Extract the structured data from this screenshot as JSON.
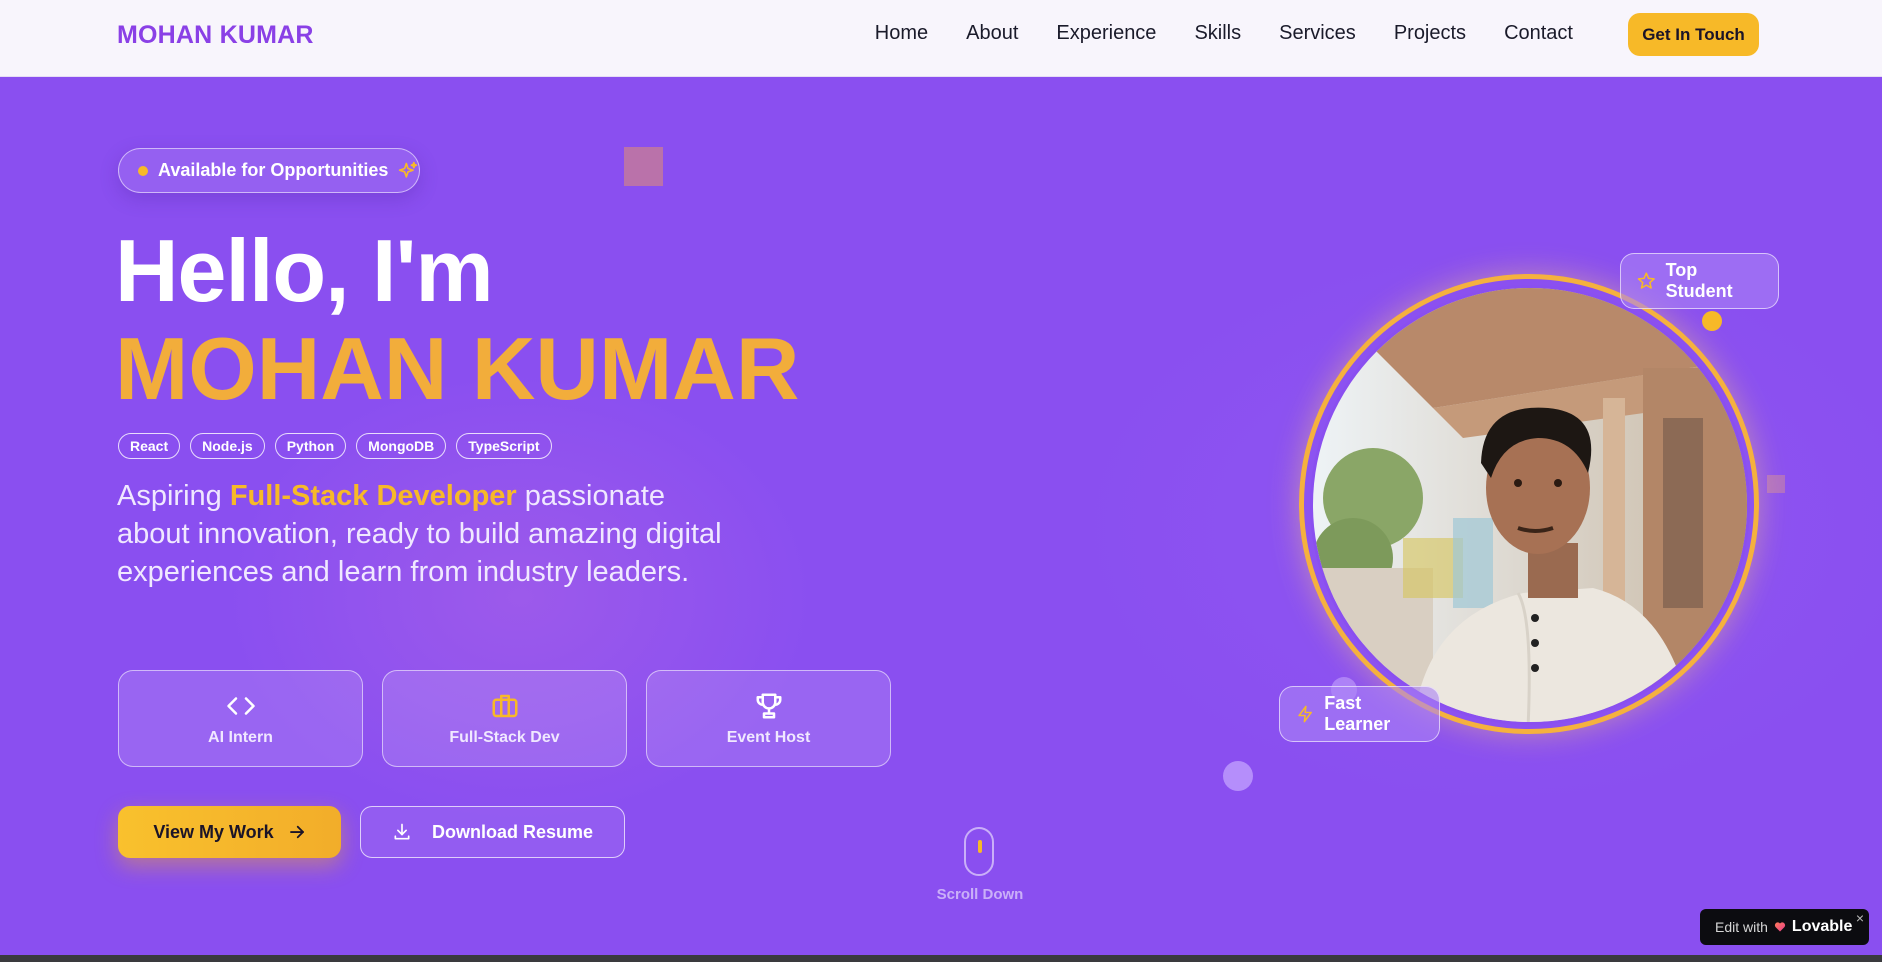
{
  "nav": {
    "brand": "MOHAN KUMAR",
    "links": [
      "Home",
      "About",
      "Experience",
      "Skills",
      "Services",
      "Projects",
      "Contact"
    ],
    "cta": "Get In Touch"
  },
  "hero": {
    "availability": "Available for Opportunities",
    "greeting": "Hello, I'm",
    "name": "MOHAN KUMAR",
    "tags": [
      "React",
      "Node.js",
      "Python",
      "MongoDB",
      "TypeScript"
    ],
    "description": {
      "before": "Aspiring ",
      "highlight": "Full-Stack Developer",
      "after": " passionate about innovation, ready to build amazing digital experiences and learn from industry leaders."
    },
    "cards": [
      {
        "label": "AI Intern",
        "icon": "code-icon"
      },
      {
        "label": "Full-Stack Dev",
        "icon": "briefcase-icon"
      },
      {
        "label": "Event Host",
        "icon": "trophy-icon"
      }
    ],
    "primary_button": "View My Work",
    "secondary_button": "Download Resume",
    "scroll_label": "Scroll Down",
    "badges": {
      "top": "Top Student",
      "fast": "Fast Learner"
    }
  },
  "lovable": {
    "edit_text": "Edit with",
    "brand": "Lovable",
    "close": "×"
  },
  "colors": {
    "accent": "#8a40e6",
    "hero_bg": "#8a4ff0",
    "highlight": "#f7b928",
    "name": "#f2ad3b"
  }
}
